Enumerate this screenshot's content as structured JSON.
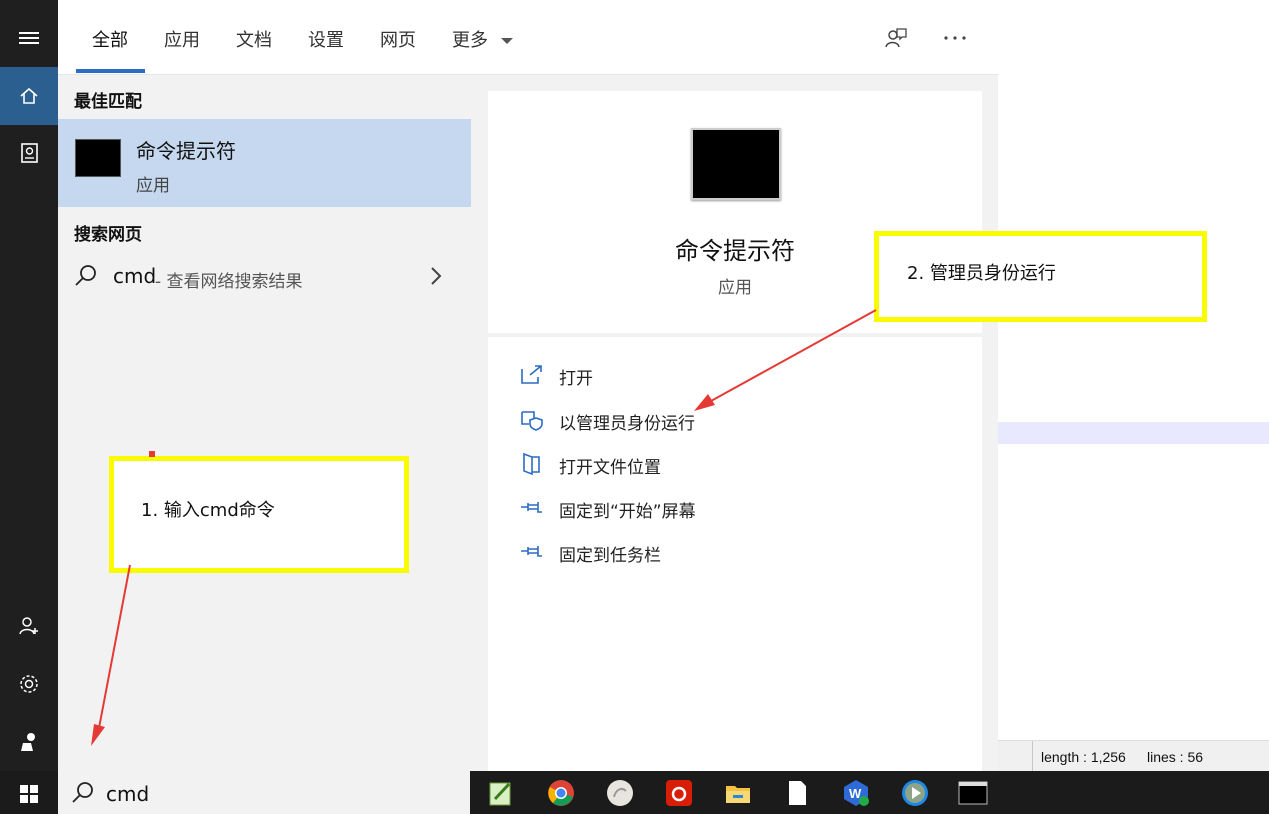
{
  "tabs": [
    {
      "label": "全部",
      "active": true
    },
    {
      "label": "应用"
    },
    {
      "label": "文档"
    },
    {
      "label": "设置"
    },
    {
      "label": "网页"
    },
    {
      "label": "更多"
    }
  ],
  "header_icons": [
    "feedback-icon",
    "more-icon"
  ],
  "results": {
    "best_match_heading": "最佳匹配",
    "best_match": {
      "title": "命令提示符",
      "subtitle": "应用",
      "icon": "cmd-app-icon"
    },
    "web_heading": "搜索网页",
    "web_item": {
      "query": "cmd",
      "suffix": " - 查看网络搜索结果"
    }
  },
  "detail": {
    "title": "命令提示符",
    "subtitle": "应用",
    "actions": [
      {
        "label": "打开",
        "icon": "open-icon"
      },
      {
        "label": "以管理员身份运行",
        "icon": "shield-icon"
      },
      {
        "label": "打开文件位置",
        "icon": "folder-location-icon"
      },
      {
        "label": "固定到“开始”屏幕",
        "icon": "pin-icon"
      },
      {
        "label": "固定到任务栏",
        "icon": "pin-icon"
      }
    ]
  },
  "rail": [
    "hamburger-icon",
    "home-icon",
    "notebook-icon",
    "account-add-icon",
    "settings-icon",
    "user-icon"
  ],
  "search": {
    "value": "cmd"
  },
  "background_editor": {
    "length": "length : 1,256",
    "lines": "lines : 56"
  },
  "annotations": {
    "note1": "1. 输入cmd命令",
    "note2": "2. 管理员身份运行"
  },
  "taskbar_apps": [
    "notepad-plus-icon",
    "chrome-icon",
    "app-icon",
    "netease-music-icon",
    "file-explorer-icon",
    "document-icon",
    "wps-icon",
    "media-player-icon",
    "terminal-icon"
  ],
  "colors": {
    "accent": "#2b6cc4",
    "selected": "#c6d8ef",
    "rail_active": "#2b5f8f",
    "callout": "#fafa00",
    "arrow": "#e53935"
  }
}
